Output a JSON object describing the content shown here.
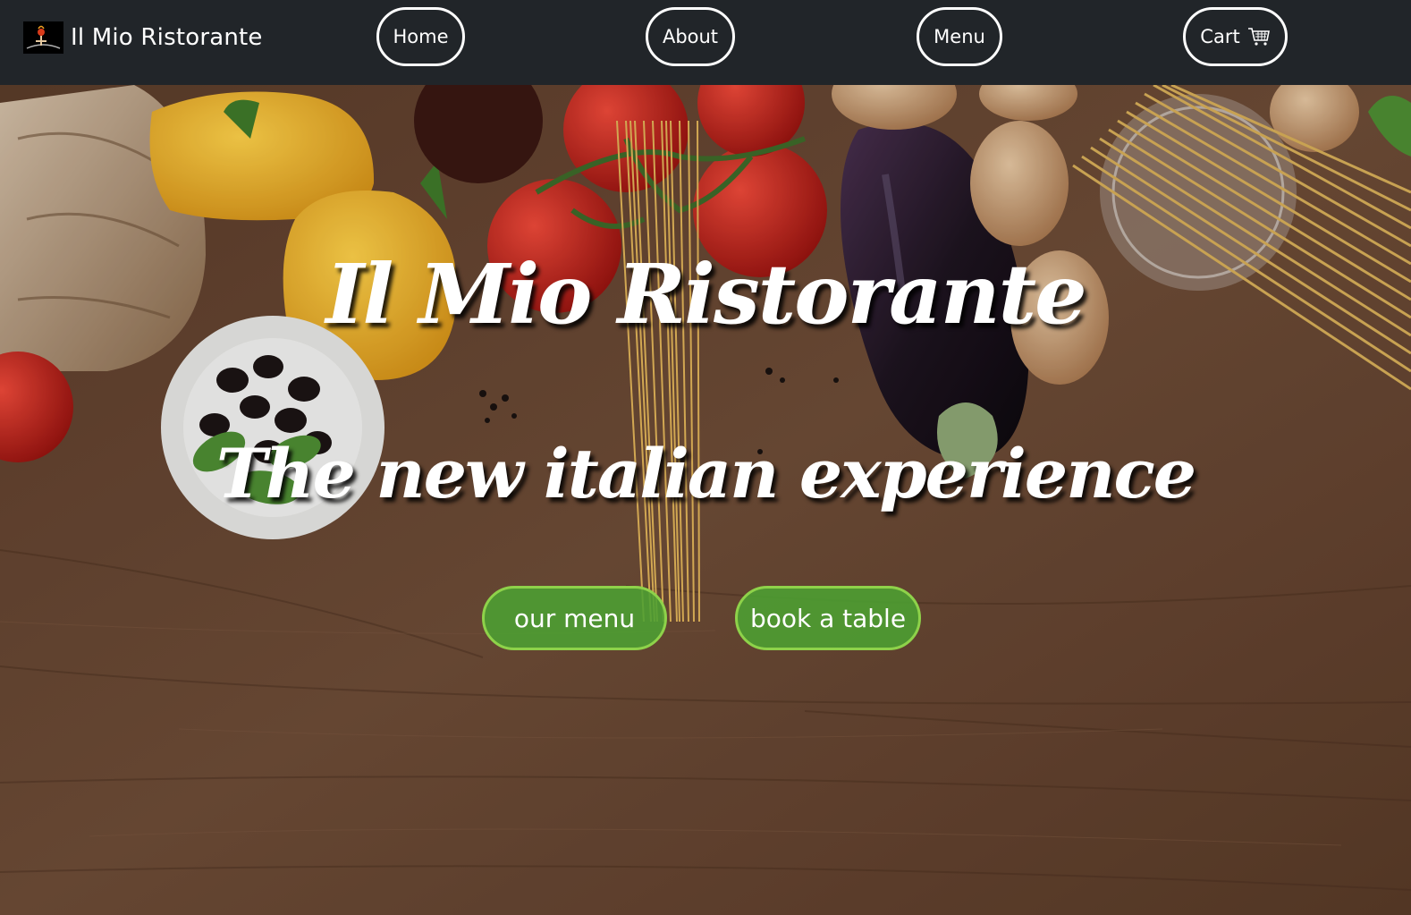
{
  "navbar": {
    "brand_name": "Il Mio Ristorante",
    "brand_logo_icon": "chef-logo-icon",
    "items": [
      {
        "label": "Home"
      },
      {
        "label": "About"
      },
      {
        "label": "Menu"
      },
      {
        "label": "Cart",
        "icon": "shopping-cart-icon"
      }
    ]
  },
  "hero": {
    "title": "Il Mio Ristorante",
    "subtitle": "The new italian experience",
    "background_image": "italian-ingredients-on-wooden-table",
    "buttons": {
      "our_menu": "our menu",
      "book_table": "book a table"
    }
  },
  "colors": {
    "navbar_bg": "#212529",
    "nav_text": "#ffffff",
    "cta_bg": "#4ca032",
    "cta_border": "#8ed24a",
    "wood": "#6b4a35"
  }
}
